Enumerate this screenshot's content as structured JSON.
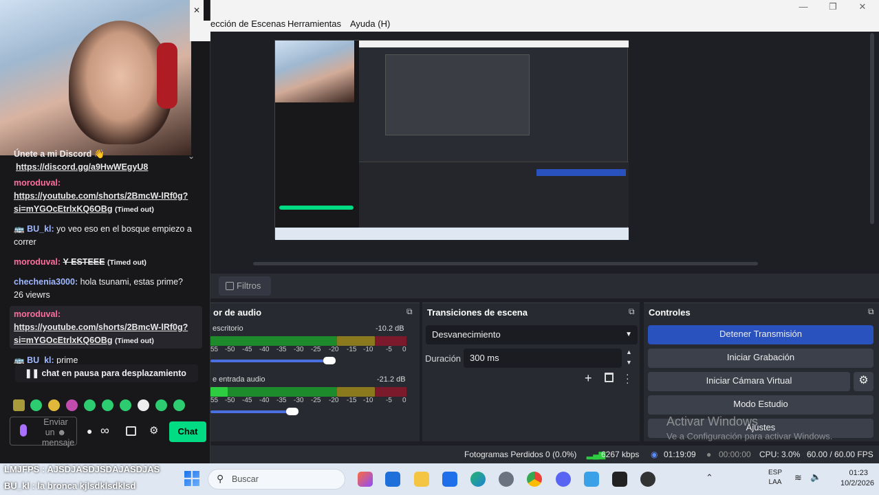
{
  "menu": {
    "items": [
      "ección de Escenas",
      "Herramientas",
      "Ayuda (H)"
    ]
  },
  "window_controls": {
    "minimize": "—",
    "restore": "❐",
    "close": "✕"
  },
  "chat": {
    "close": "✕",
    "pinned": {
      "title": "Únete a mi Discord 👋",
      "link": "https://discord.gg/a9HwWEgyU8"
    },
    "messages": [
      {
        "user": "moroduval:",
        "link1": "https://youtube.com/shorts/2BmcW-lRf0g?",
        "link2": "si=mYGOcEtrlxKQ6OBg",
        "note": "(Timed out)"
      },
      {
        "user": "BU_kl:",
        "text": "yo veo eso en el bosque empiezo a",
        "text2": "correr"
      },
      {
        "user": "moroduval:",
        "text": "Y ESTEEE",
        "note": "(Timed out)"
      },
      {
        "user": "chechenia3000:",
        "text": "hola tsunami, estas prime?",
        "text2": "26 viewrs"
      },
      {
        "user": "moroduval:",
        "link1": "https://youtube.com/shorts/2BmcW-lRf0g?",
        "link2": "si=mYGOcEtrlxKQ6OBg",
        "note": "(Timed out)"
      },
      {
        "user": "BU_kl:",
        "text": "prime"
      }
    ],
    "paused": "chat en pausa para desplazamiento",
    "input_placeholder": [
      "Enviar",
      "un",
      "mensaje"
    ],
    "chat_button": "Chat",
    "infinity": "∞"
  },
  "filters_button": "Filtros",
  "audio": {
    "title": "or de audio",
    "channels": [
      {
        "name": "escritorio",
        "db": "-10.2 dB"
      },
      {
        "name": "e entrada audio",
        "db": "-21.2 dB"
      }
    ],
    "scale": [
      "55",
      "-50",
      "-45",
      "-40",
      "-35",
      "-30",
      "-25",
      "-20",
      "-15",
      "-10",
      "-5",
      "0"
    ]
  },
  "transitions": {
    "title": "Transiciones de escena",
    "selected": "Desvanecimiento",
    "duration_label": "Duración",
    "duration_value": "300 ms"
  },
  "controls": {
    "title": "Controles",
    "buttons": [
      "Detener Transmisión",
      "Iniciar Grabación",
      "Iniciar Cámara Virtual",
      "Modo Estudio",
      "Ajustes"
    ]
  },
  "activate_windows": {
    "title": "Activar Windows",
    "subtitle": "Ve a Configuración para activar Windows."
  },
  "status": {
    "frames_dropped": "Fotogramas Perdidos 0 (0.0%)",
    "bitrate": "6267 kbps",
    "live_time": "01:19:09",
    "rec_time": "00:00:00",
    "cpu": "CPU: 3.0%",
    "fps": "60.00 / 60.00 FPS"
  },
  "overlay": {
    "line1": "LMJFPS : AJSDJASDJSDAJASDJAS",
    "line2": "BU_kl : la bronca kjlsdklsdklsd"
  },
  "taskbar": {
    "search": "Buscar",
    "lang1": "ESP",
    "lang2": "LAA",
    "time": "01:23",
    "date": "10/2/2026"
  },
  "colors": {
    "accent_blue": "#2a52be",
    "chat_green": "#00db84",
    "user_pink": "#ff6f9c",
    "user_blue": "#9fb8ff"
  }
}
